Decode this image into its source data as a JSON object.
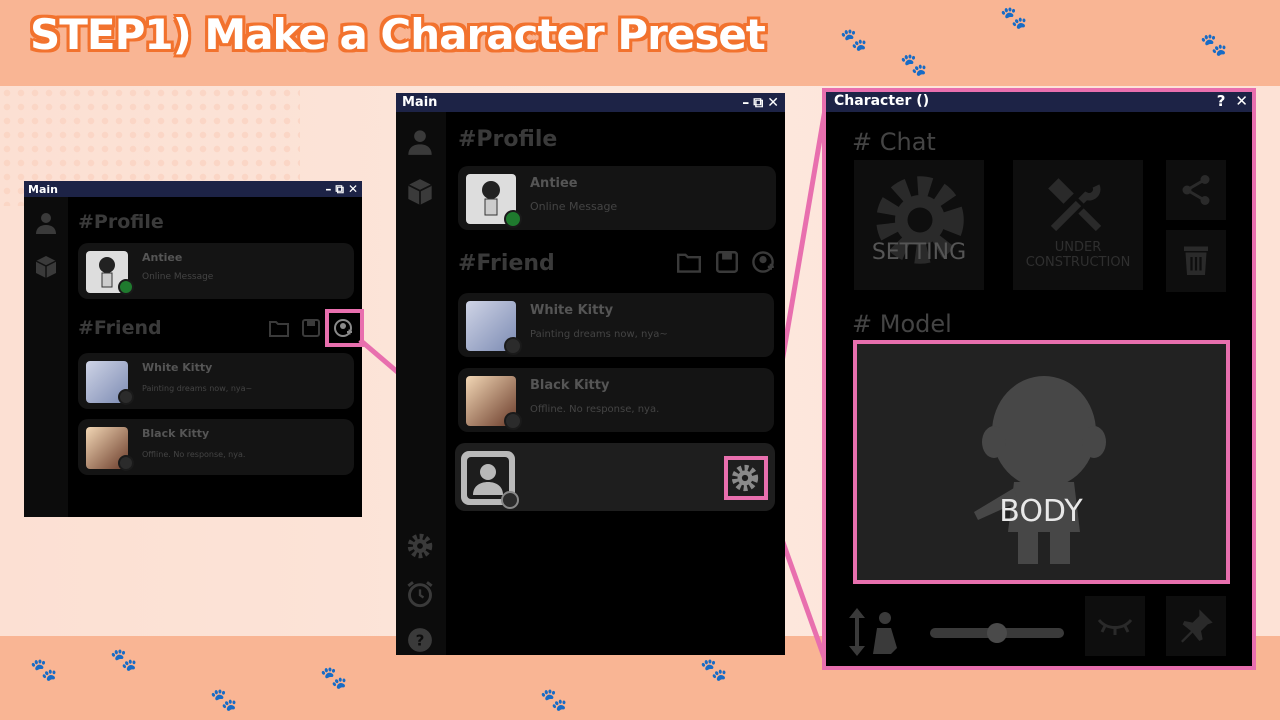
{
  "header": {
    "title": "STEP1) Make a Character Preset"
  },
  "main_small": {
    "title": "Main",
    "profile_heading": "#Profile",
    "profile": {
      "name": "Antiee",
      "status": "Online Message"
    },
    "friend_heading": "#Friend",
    "friends": [
      {
        "name": "White Kitty",
        "status": "Painting dreams now, nya~"
      },
      {
        "name": "Black Kitty",
        "status": "Offline. No response, nya."
      }
    ]
  },
  "main_large": {
    "title": "Main",
    "profile_heading": "#Profile",
    "profile": {
      "name": "Antiee",
      "status": "Online Message"
    },
    "friend_heading": "#Friend",
    "friends": [
      {
        "name": "White Kitty",
        "status": "Painting dreams now, nya~"
      },
      {
        "name": "Black Kitty",
        "status": "Offline. No response, nya."
      }
    ]
  },
  "character": {
    "title": "Character ()",
    "help": "?",
    "chat_heading": "# Chat",
    "setting_label": "SETTING",
    "under_construction": "UNDER\nCONSTRUCTION",
    "model_heading": "# Model",
    "body_label": "BODY",
    "slider_value": 0.5
  },
  "icons": {
    "minimize": "minimize-icon",
    "popout": "popout-icon",
    "close": "close-icon",
    "user": "user-icon",
    "box": "box-icon",
    "folder": "folder-icon",
    "save": "save-icon",
    "add_user": "add-user-icon",
    "gear": "gear-icon",
    "alarm": "alarm-icon",
    "help": "help-icon",
    "share": "share-icon",
    "trash": "trash-icon",
    "eye": "eye-closed-icon",
    "pin": "pin-icon"
  },
  "colors": {
    "highlight": "#e86fae",
    "titlebar": "#1d2346",
    "online": "#1f7a2e",
    "accent": "#f2722e"
  }
}
